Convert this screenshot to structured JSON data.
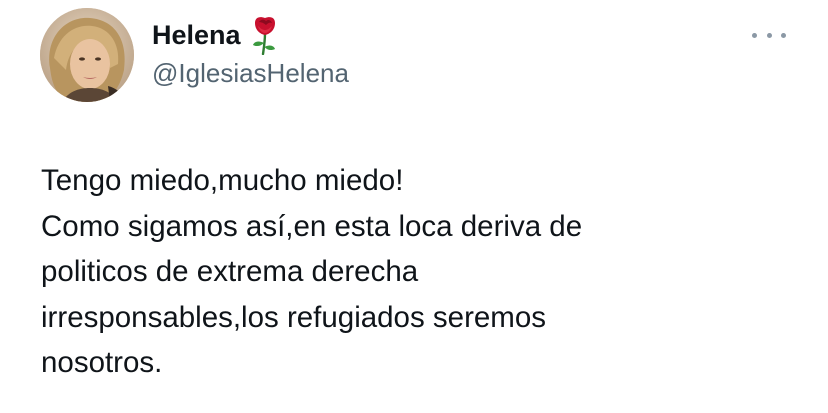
{
  "author": {
    "display_name": "Helena",
    "name_emoji_icon": "rose-icon",
    "handle": "@IglesiasHelena",
    "avatar_icon": "avatar"
  },
  "menu": {
    "icon": "more-options-icon"
  },
  "tweet": {
    "lines": [
      "Tengo miedo,mucho miedo!",
      "Como sigamos así,en esta loca deriva de",
      "politicos de extrema derecha",
      "irresponsables,los refugiados seremos",
      "nosotros."
    ]
  },
  "colors": {
    "text_primary": "#0f1419",
    "text_secondary": "#536471",
    "menu_dots": "#8b98a5",
    "rose": "#c8102e",
    "background": "#ffffff"
  }
}
